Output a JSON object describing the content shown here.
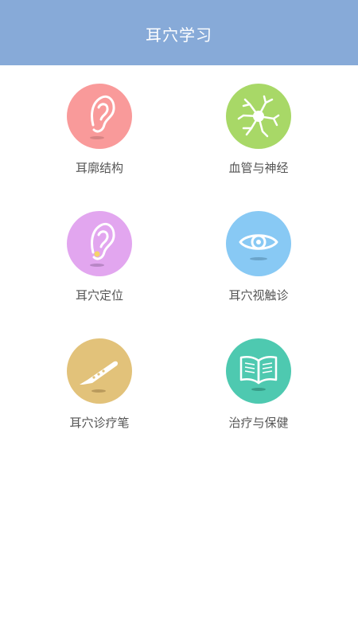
{
  "header": {
    "title": "耳穴学习"
  },
  "tiles": [
    {
      "label": "耳廓结构",
      "color": "#f99a9a",
      "icon": "ear-icon"
    },
    {
      "label": "血管与神经",
      "color": "#a8d867",
      "icon": "neuron-icon"
    },
    {
      "label": "耳穴定位",
      "color": "#e2a6ef",
      "icon": "ear-point-icon"
    },
    {
      "label": "耳穴视触诊",
      "color": "#88c9f4",
      "icon": "eye-icon"
    },
    {
      "label": "耳穴诊疗笔",
      "color": "#e2c27a",
      "icon": "pen-icon"
    },
    {
      "label": "治疗与保健",
      "color": "#4ec9b0",
      "icon": "book-icon"
    }
  ]
}
